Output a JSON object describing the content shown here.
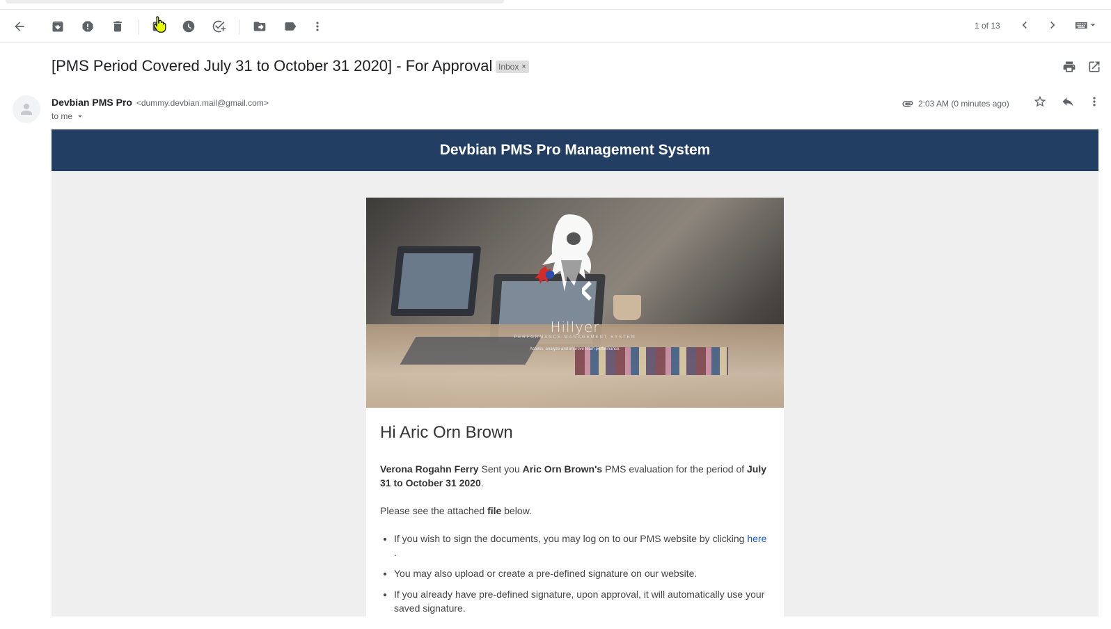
{
  "toolbar": {
    "pager_text": "1 of 13"
  },
  "message": {
    "subject": "[PMS Period Covered July 31 to October 31 2020] - For Approval",
    "label": "Inbox",
    "label_remove": "×",
    "sender_name": "Devbian PMS Pro",
    "sender_email": "<dummy.devbian.mail@gmail.com>",
    "recipient": "to me",
    "time": "2:03 AM (0 minutes ago)"
  },
  "email_body": {
    "banner_title": "Devbian PMS Pro Management System",
    "hero": {
      "brand": "Hillyer",
      "tagline1": "PERFORMANCE MANAGEMENT SYSTEM",
      "tagline2": "Assess, analyze and improve team performance."
    },
    "greeting": "Hi Aric Orn Brown",
    "para1": {
      "sender_bold": "Verona Rogahn Ferry",
      "text1": " Sent you ",
      "employee_bold": "Aric Orn Brown's",
      "text2": " PMS evaluation for the period of ",
      "period_bold": "July 31 to October 31 2020",
      "text3": "."
    },
    "para2": {
      "text1": "Please see the attached ",
      "bold": "file",
      "text2": " below."
    },
    "bullets": {
      "b1_text": "If you wish to sign the documents, you may log on to our PMS website by clicking ",
      "b1_link": "here",
      "b1_end": " .",
      "b2_text": "You may also upload or create a pre-defined signature on our website.",
      "b3_text": "If you already have pre-defined signature, upon approval, it will automatically use your saved signature."
    }
  }
}
